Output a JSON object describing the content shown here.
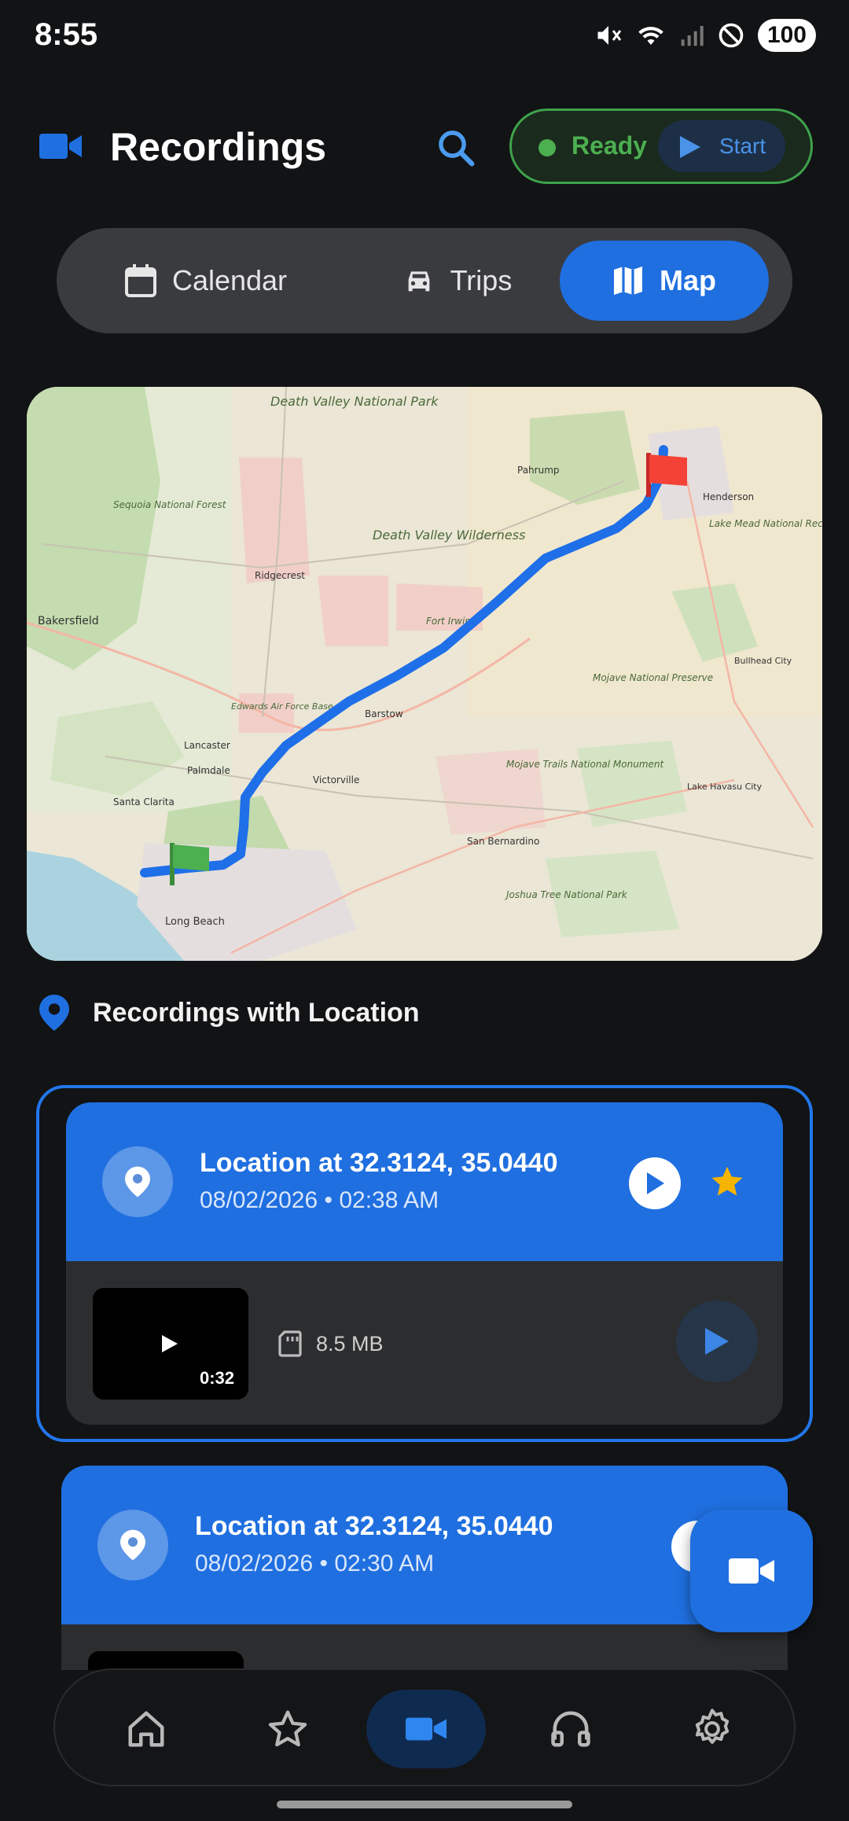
{
  "status_bar": {
    "time": "8:55",
    "battery": "100"
  },
  "header": {
    "title": "Recordings",
    "status_text": "Ready",
    "start_label": "Start"
  },
  "tabs": [
    {
      "label": "Calendar",
      "icon": "calendar-icon"
    },
    {
      "label": "Trips",
      "icon": "car-icon"
    },
    {
      "label": "Map",
      "icon": "map-icon",
      "selected": true
    }
  ],
  "map": {
    "labels": {
      "death_valley_np": "Death Valley National Park",
      "death_valley_wild": "Death Valley Wilderness",
      "sequoia": "Sequoia National Forest",
      "bakersfield": "Bakersfield",
      "ridgecrest": "Ridgecrest",
      "fort_irwin": "Fort Irwin",
      "lancaster": "Lancaster",
      "palmdale": "Palmdale",
      "santa_clarita": "Santa Clarita",
      "long_beach": "Long Beach",
      "henderson": "Henderson",
      "lake_mead": "Lake Mead National Recreation Area",
      "mojave_preserve": "Mojave National Preserve",
      "mojave_trails": "Mojave Trails National Monument",
      "joshua_tree": "Joshua Tree National Park",
      "san_bernardino": "San Bernardino",
      "victorville": "Victorville",
      "barstow": "Barstow",
      "pahrump": "Pahrump",
      "edwards": "Edwards Air Force Base",
      "bullhead": "Bullhead City",
      "lake_havasu": "Lake Havasu City"
    }
  },
  "section": {
    "title": "Recordings with Location"
  },
  "recordings": [
    {
      "title": "Location at 32.3124, 35.0440",
      "date": "08/02/2026 • 02:38 AM",
      "duration": "0:32",
      "size": "8.5 MB",
      "favorite": true
    },
    {
      "title": "Location at 32.3124, 35.0440",
      "date": "08/02/2026 • 02:30 AM"
    }
  ],
  "colors": {
    "accent": "#1f6fe0",
    "ready": "#4caf50",
    "background": "#121315",
    "route": "#1e6fe8",
    "star": "#f5b400"
  },
  "nav": [
    "home-icon",
    "star-icon",
    "video-camera-icon",
    "headphones-icon",
    "gear-icon"
  ]
}
